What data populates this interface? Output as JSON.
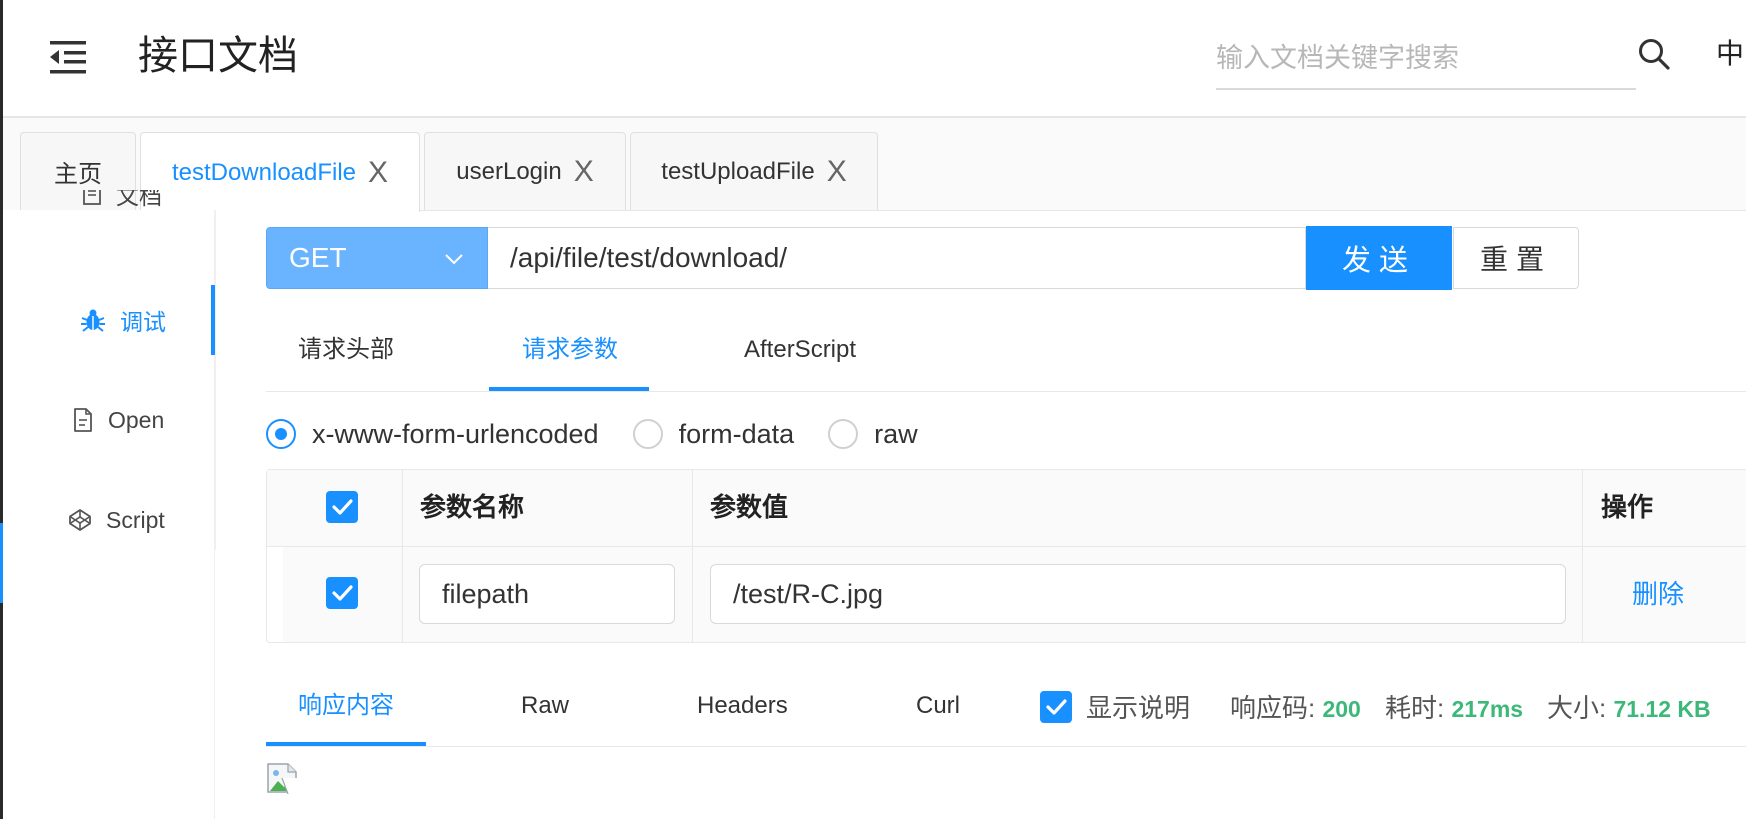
{
  "header": {
    "title": "接口文档",
    "search_placeholder": "输入文档关键字搜索",
    "lang": "中"
  },
  "tabs": [
    {
      "label": "主页",
      "closable": false
    },
    {
      "label": "testDownloadFile",
      "closable": true,
      "active": true
    },
    {
      "label": "userLogin",
      "closable": true
    },
    {
      "label": "testUploadFile",
      "closable": true
    }
  ],
  "tab_close_glyph": "X",
  "sidebar": {
    "items": [
      {
        "label": "文档",
        "icon": "document-icon"
      },
      {
        "label": "调试",
        "icon": "bug-icon",
        "active": true
      },
      {
        "label": "Open",
        "icon": "file-icon"
      },
      {
        "label": "Script",
        "icon": "codepen-icon"
      }
    ]
  },
  "request": {
    "method": "GET",
    "url": "/api/file/test/download/",
    "send_label": "发送",
    "reset_label": "重置"
  },
  "request_tabs": [
    {
      "label": "请求头部"
    },
    {
      "label": "请求参数",
      "active": true
    },
    {
      "label": "AfterScript"
    }
  ],
  "body_types": [
    {
      "label": "x-www-form-urlencoded",
      "selected": true
    },
    {
      "label": "form-data",
      "selected": false
    },
    {
      "label": "raw",
      "selected": false
    }
  ],
  "params_table": {
    "headers": {
      "name": "参数名称",
      "value": "参数值",
      "action": "操作"
    },
    "rows": [
      {
        "checked": true,
        "name": "filepath",
        "value": "/test/R-C.jpg",
        "action": "删除"
      }
    ]
  },
  "response": {
    "tabs": [
      {
        "label": "响应内容",
        "active": true
      },
      {
        "label": "Raw"
      },
      {
        "label": "Headers"
      },
      {
        "label": "Curl"
      }
    ],
    "show_desc_label": "显示说明",
    "show_desc_checked": true,
    "status_label": "响应码:",
    "status_value": "200",
    "time_label": "耗时:",
    "time_value": "217ms",
    "size_label": "大小:",
    "size_value": "71.12 KB"
  },
  "colors": {
    "accent": "#1890ff",
    "method_bg": "#6ab4ff",
    "success": "#3cb878"
  }
}
